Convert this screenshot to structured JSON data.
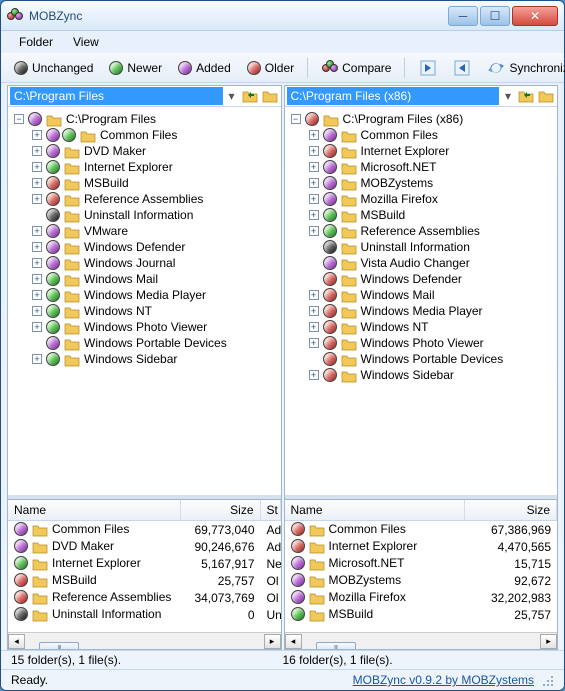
{
  "window": {
    "title": "MOBZync"
  },
  "menu": {
    "folder": "Folder",
    "view": "View"
  },
  "toolbar": {
    "unchanged": "Unchanged",
    "newer": "Newer",
    "added": "Added",
    "older": "Older",
    "compare": "Compare",
    "synchronize": "Synchronize"
  },
  "left": {
    "path": "C:\\Program Files",
    "root": {
      "name": "C:\\Program Files",
      "ball": "purple",
      "expandable": true,
      "expanded": true
    },
    "tree": [
      {
        "name": "Common Files",
        "ball": "purple",
        "ball2": "green",
        "expandable": true
      },
      {
        "name": "DVD Maker",
        "ball": "purple",
        "expandable": true
      },
      {
        "name": "Internet Explorer",
        "ball": "green",
        "expandable": true
      },
      {
        "name": "MSBuild",
        "ball": "red",
        "expandable": true
      },
      {
        "name": "Reference Assemblies",
        "ball": "red",
        "expandable": true
      },
      {
        "name": "Uninstall Information",
        "ball": "black",
        "expandable": false
      },
      {
        "name": "VMware",
        "ball": "purple",
        "expandable": true
      },
      {
        "name": "Windows Defender",
        "ball": "purple",
        "expandable": true
      },
      {
        "name": "Windows Journal",
        "ball": "purple",
        "expandable": true
      },
      {
        "name": "Windows Mail",
        "ball": "green",
        "expandable": true
      },
      {
        "name": "Windows Media Player",
        "ball": "green",
        "expandable": true
      },
      {
        "name": "Windows NT",
        "ball": "green",
        "expandable": true
      },
      {
        "name": "Windows Photo Viewer",
        "ball": "green",
        "expandable": true
      },
      {
        "name": "Windows Portable Devices",
        "ball": "purple",
        "expandable": false
      },
      {
        "name": "Windows Sidebar",
        "ball": "green",
        "expandable": true
      }
    ],
    "list_headers": {
      "name": "Name",
      "size": "Size",
      "st": "St"
    },
    "list": [
      {
        "name": "Common Files",
        "ball": "purple",
        "size": "69,773,040",
        "st": "Ad"
      },
      {
        "name": "DVD Maker",
        "ball": "purple",
        "size": "90,246,676",
        "st": "Ad"
      },
      {
        "name": "Internet Explorer",
        "ball": "green",
        "size": "5,167,917",
        "st": "Ne"
      },
      {
        "name": "MSBuild",
        "ball": "red",
        "size": "25,757",
        "st": "Ol"
      },
      {
        "name": "Reference Assemblies",
        "ball": "red",
        "size": "34,073,769",
        "st": "Ol"
      },
      {
        "name": "Uninstall Information",
        "ball": "black",
        "size": "0",
        "st": "Un"
      }
    ],
    "summary": "15 folder(s), 1 file(s)."
  },
  "right": {
    "path": "C:\\Program Files (x86)",
    "root": {
      "name": "C:\\Program Files (x86)",
      "ball": "red",
      "expandable": true,
      "expanded": true
    },
    "tree": [
      {
        "name": "Common Files",
        "ball": "purple",
        "expandable": true
      },
      {
        "name": "Internet Explorer",
        "ball": "red",
        "expandable": true
      },
      {
        "name": "Microsoft.NET",
        "ball": "purple",
        "expandable": true
      },
      {
        "name": "MOBZystems",
        "ball": "purple",
        "expandable": true
      },
      {
        "name": "Mozilla Firefox",
        "ball": "purple",
        "expandable": true
      },
      {
        "name": "MSBuild",
        "ball": "green",
        "expandable": true
      },
      {
        "name": "Reference Assemblies",
        "ball": "green",
        "expandable": true
      },
      {
        "name": "Uninstall Information",
        "ball": "black",
        "expandable": false
      },
      {
        "name": "Vista Audio Changer",
        "ball": "purple",
        "expandable": false
      },
      {
        "name": "Windows Defender",
        "ball": "red",
        "expandable": false
      },
      {
        "name": "Windows Mail",
        "ball": "red",
        "expandable": true
      },
      {
        "name": "Windows Media Player",
        "ball": "red",
        "expandable": true
      },
      {
        "name": "Windows NT",
        "ball": "red",
        "expandable": true
      },
      {
        "name": "Windows Photo Viewer",
        "ball": "red",
        "expandable": true
      },
      {
        "name": "Windows Portable Devices",
        "ball": "red",
        "expandable": false
      },
      {
        "name": "Windows Sidebar",
        "ball": "red",
        "expandable": true
      }
    ],
    "list_headers": {
      "name": "Name",
      "size": "Size"
    },
    "list": [
      {
        "name": "Common Files",
        "ball": "red",
        "size": "67,386,969"
      },
      {
        "name": "Internet Explorer",
        "ball": "red",
        "size": "4,470,565"
      },
      {
        "name": "Microsoft.NET",
        "ball": "purple",
        "size": "15,715"
      },
      {
        "name": "MOBZystems",
        "ball": "purple",
        "size": "92,672"
      },
      {
        "name": "Mozilla Firefox",
        "ball": "purple",
        "size": "32,202,983"
      },
      {
        "name": "MSBuild",
        "ball": "green",
        "size": "25,757"
      }
    ],
    "summary": "16 folder(s), 1 file(s)."
  },
  "status": {
    "ready": "Ready.",
    "link": "MOBZync v0.9.2 by MOBZystems"
  }
}
